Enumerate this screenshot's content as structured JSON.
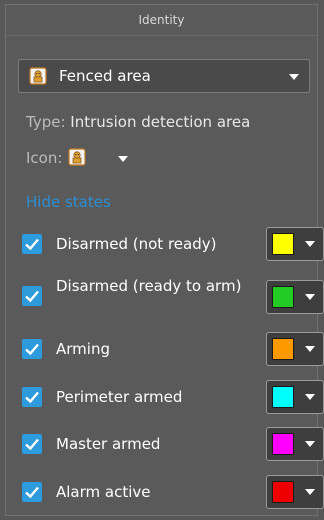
{
  "header": {
    "title": "Identity"
  },
  "entity_dropdown": {
    "value": "Fenced area",
    "icon": "fenced-area-icon"
  },
  "type_row": {
    "key": "Type:",
    "value": "Intrusion detection area"
  },
  "icon_row": {
    "key": "Icon:",
    "icon": "fenced-area-icon"
  },
  "hide_states_label": "Hide states",
  "states": [
    {
      "label": "Disarmed (not ready)",
      "checked": true,
      "color": "#FFFF00"
    },
    {
      "label": "Disarmed (ready to arm)",
      "checked": true,
      "color": "#22CC22"
    },
    {
      "label": "Arming",
      "checked": true,
      "color": "#FF9900"
    },
    {
      "label": "Perimeter armed",
      "checked": true,
      "color": "#00FFFF"
    },
    {
      "label": "Master armed",
      "checked": true,
      "color": "#FF00FF"
    },
    {
      "label": "Alarm active",
      "checked": true,
      "color": "#EE0000"
    }
  ]
}
